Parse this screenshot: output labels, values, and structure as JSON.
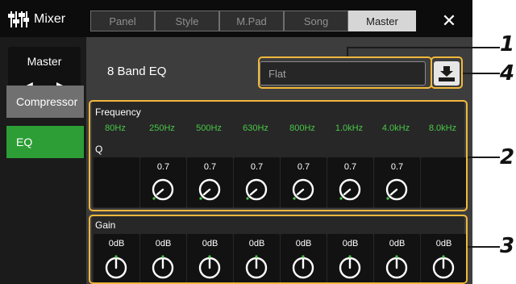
{
  "app": {
    "title": "Mixer",
    "icon": "mixer-sliders-icon"
  },
  "tabs": [
    {
      "label": "Panel",
      "active": false
    },
    {
      "label": "Style",
      "active": false
    },
    {
      "label": "M.Pad",
      "active": false
    },
    {
      "label": "Song",
      "active": false
    },
    {
      "label": "Master",
      "active": true
    }
  ],
  "close_label": "✕",
  "sidebar": {
    "title": "Master",
    "prev_arrow": "◀",
    "next_arrow": "▶",
    "items": [
      {
        "label": "Compressor",
        "active": false
      },
      {
        "label": "EQ",
        "active": true
      }
    ]
  },
  "eq": {
    "title": "8 Band EQ",
    "preset": "Flat",
    "save_icon": "save-icon",
    "frequency_label": "Frequency",
    "frequencies": [
      "80Hz",
      "250Hz",
      "500Hz",
      "630Hz",
      "800Hz",
      "1.0kHz",
      "4.0kHz",
      "8.0kHz"
    ],
    "q_label": "Q",
    "q_values": [
      "",
      "0.7",
      "0.7",
      "0.7",
      "0.7",
      "0.7",
      "0.7",
      ""
    ],
    "gain_label": "Gain",
    "gain_values": [
      "0dB",
      "0dB",
      "0dB",
      "0dB",
      "0dB",
      "0dB",
      "0dB",
      "0dB"
    ]
  },
  "callouts": [
    "1",
    "2",
    "3",
    "4"
  ],
  "colors": {
    "accent_green": "#2c9e35",
    "frequency_text": "#49c749",
    "highlight_frame": "#f2b83c"
  }
}
